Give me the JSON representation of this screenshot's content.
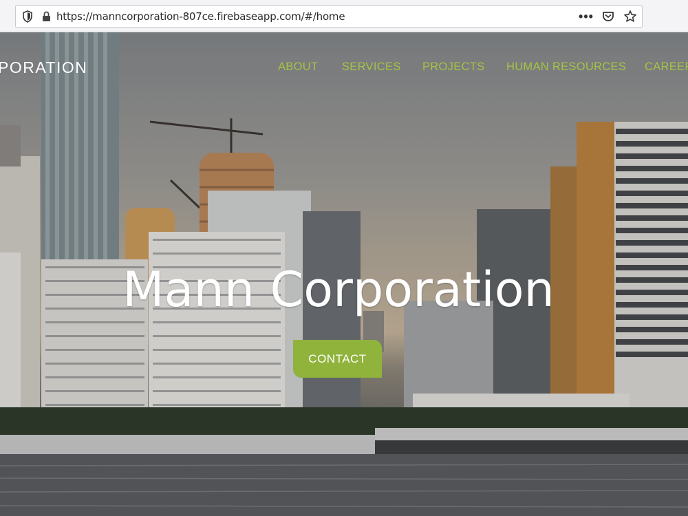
{
  "browser": {
    "url": "https://manncorporation-807ce.firebaseapp.com/#/home",
    "icons": [
      "shield-icon",
      "lock-icon",
      "more-icon",
      "pocket-icon",
      "bookmark-star-icon"
    ],
    "more_glyph": "•••"
  },
  "site": {
    "brand": "PORATION",
    "nav": [
      "ABOUT",
      "SERVICES",
      "PROJECTS",
      "HUMAN RESOURCES",
      "CAREER"
    ],
    "hero_title": "Mann Corporation",
    "cta_label": "CONTACT"
  },
  "colors": {
    "nav_accent": "#a4c444",
    "button": "#8fb33b",
    "title": "#ffffff"
  }
}
